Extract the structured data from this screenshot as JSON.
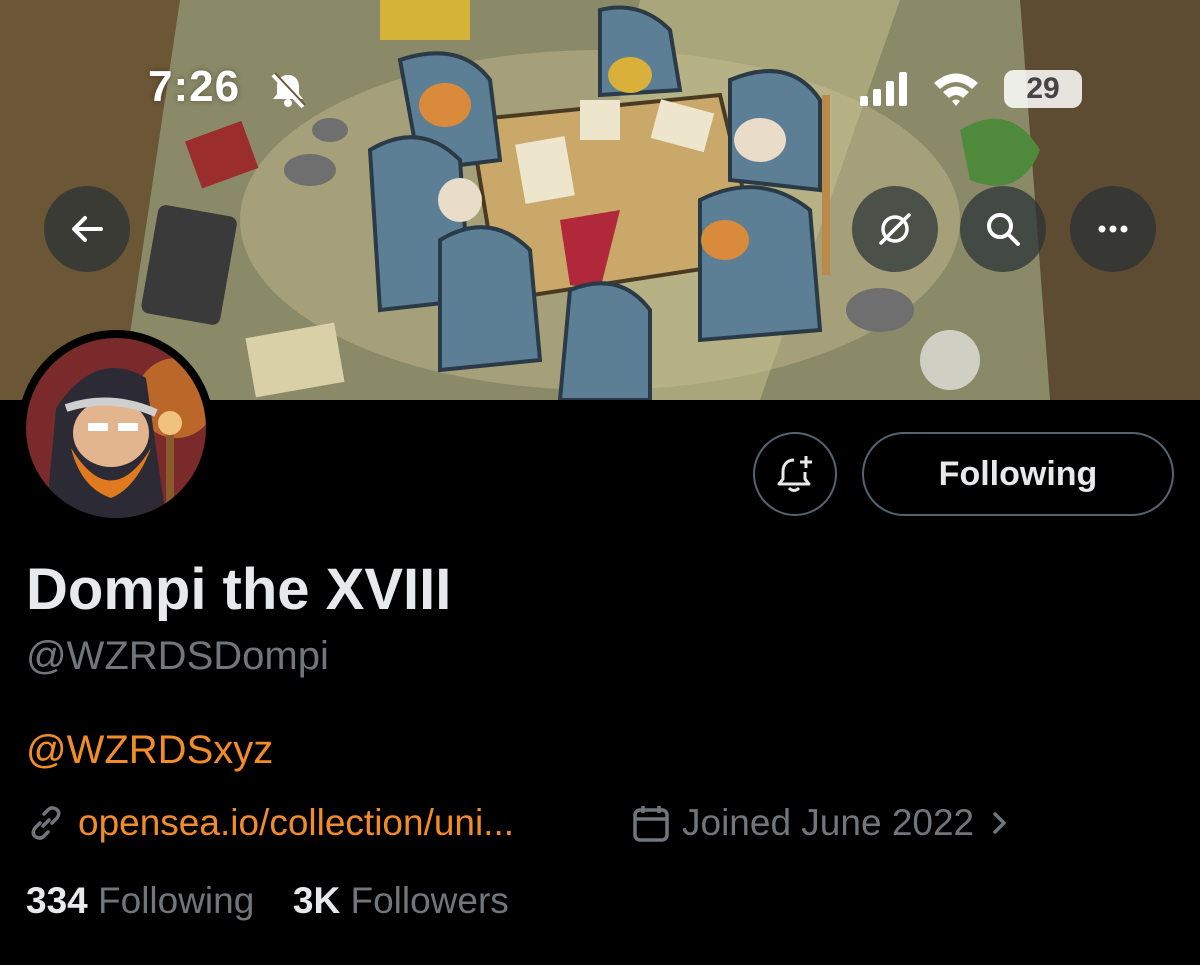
{
  "status_bar": {
    "time": "7:26",
    "battery": "29"
  },
  "profile": {
    "display_name": "Dompi the XVIII",
    "handle": "@WZRDSDompi",
    "bio": "@WZRDSxyz",
    "website": "opensea.io/collection/uni...",
    "joined": "Joined June 2022",
    "following_count": "334",
    "following_label": "Following",
    "followers_count": "3K",
    "followers_label": "Followers"
  },
  "actions": {
    "following_button": "Following"
  },
  "icons": {
    "back": "arrow-left-icon",
    "grok": "grok-icon",
    "search": "search-icon",
    "more": "more-icon",
    "notify": "bell-plus-icon",
    "link": "link-icon",
    "calendar": "calendar-icon"
  },
  "colors": {
    "accent": "#f28c28",
    "muted": "#71767b",
    "text": "#e7e9ea",
    "background": "#000000"
  }
}
